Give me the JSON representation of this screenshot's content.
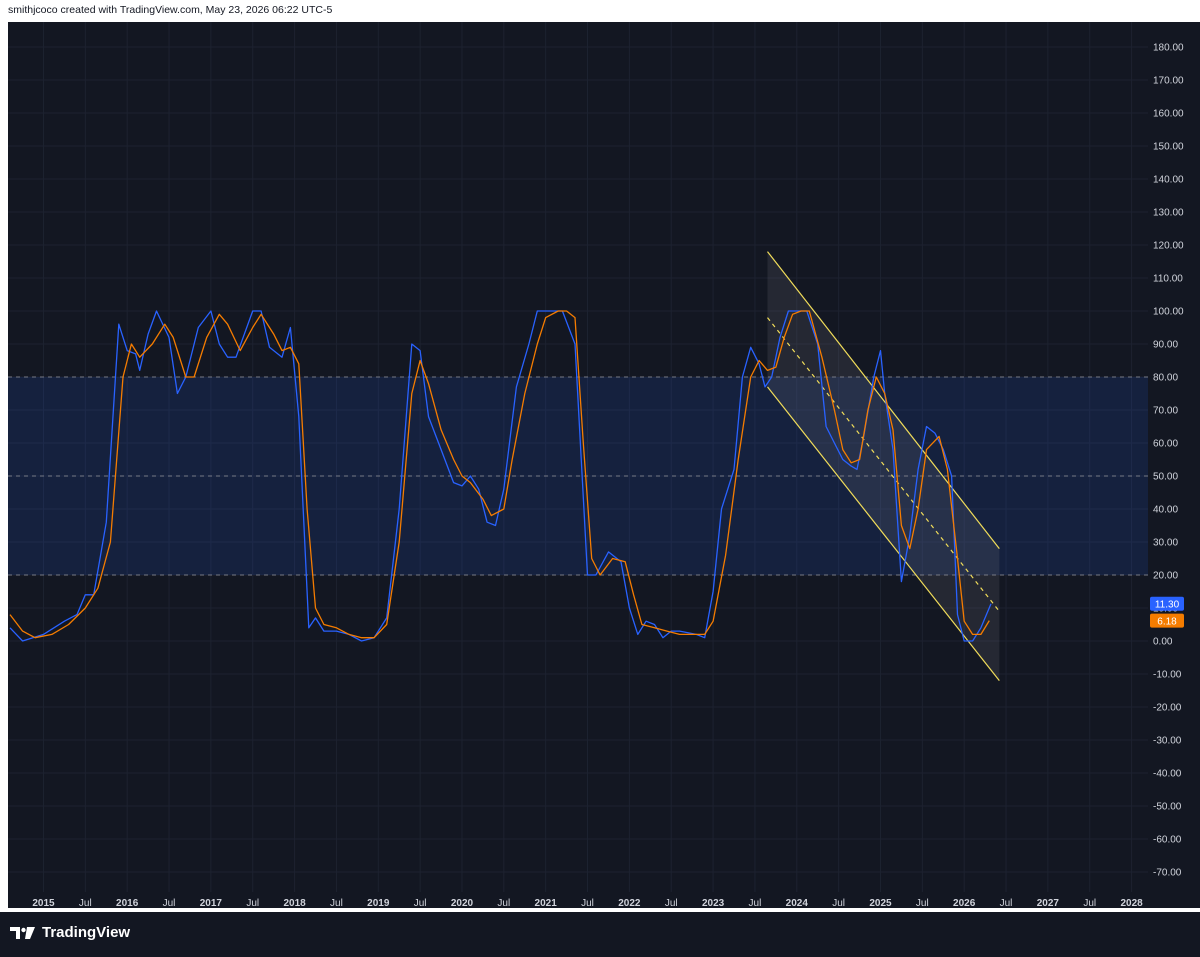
{
  "header": {
    "text": "smithjcoco created with TradingView.com, May 23, 2026 06:22 UTC-5"
  },
  "footer": {
    "brand": "TradingView"
  },
  "chart_data": {
    "type": "line",
    "y_range": [
      -75,
      185
    ],
    "y_ticks": [
      "180.00",
      "170.00",
      "160.00",
      "150.00",
      "140.00",
      "130.00",
      "120.00",
      "110.00",
      "100.00",
      "90.00",
      "80.00",
      "70.00",
      "60.00",
      "50.00",
      "40.00",
      "30.00",
      "20.00",
      "10.00",
      "0.00",
      "-10.00",
      "-20.00",
      "-30.00",
      "-40.00",
      "-50.00",
      "-60.00",
      "-70.00"
    ],
    "x_range": [
      2014.6,
      2028.15
    ],
    "x_ticks": [
      {
        "t": 2015.0,
        "label": "2015",
        "bold": true
      },
      {
        "t": 2015.5,
        "label": "Jul",
        "bold": false
      },
      {
        "t": 2016.0,
        "label": "2016",
        "bold": true
      },
      {
        "t": 2016.5,
        "label": "Jul",
        "bold": false
      },
      {
        "t": 2017.0,
        "label": "2017",
        "bold": true
      },
      {
        "t": 2017.5,
        "label": "Jul",
        "bold": false
      },
      {
        "t": 2018.0,
        "label": "2018",
        "bold": true
      },
      {
        "t": 2018.5,
        "label": "Jul",
        "bold": false
      },
      {
        "t": 2019.0,
        "label": "2019",
        "bold": true
      },
      {
        "t": 2019.5,
        "label": "Jul",
        "bold": false
      },
      {
        "t": 2020.0,
        "label": "2020",
        "bold": true
      },
      {
        "t": 2020.5,
        "label": "Jul",
        "bold": false
      },
      {
        "t": 2021.0,
        "label": "2021",
        "bold": true
      },
      {
        "t": 2021.5,
        "label": "Jul",
        "bold": false
      },
      {
        "t": 2022.0,
        "label": "2022",
        "bold": true
      },
      {
        "t": 2022.5,
        "label": "Jul",
        "bold": false
      },
      {
        "t": 2023.0,
        "label": "2023",
        "bold": true
      },
      {
        "t": 2023.5,
        "label": "Jul",
        "bold": false
      },
      {
        "t": 2024.0,
        "label": "2024",
        "bold": true
      },
      {
        "t": 2024.5,
        "label": "Jul",
        "bold": false
      },
      {
        "t": 2025.0,
        "label": "2025",
        "bold": true
      },
      {
        "t": 2025.5,
        "label": "Jul",
        "bold": false
      },
      {
        "t": 2026.0,
        "label": "2026",
        "bold": true
      },
      {
        "t": 2026.5,
        "label": "Jul",
        "bold": false
      },
      {
        "t": 2027.0,
        "label": "2027",
        "bold": true
      },
      {
        "t": 2027.5,
        "label": "Jul",
        "bold": false
      },
      {
        "t": 2028.0,
        "label": "2028",
        "bold": true
      }
    ],
    "band": {
      "upper": 80,
      "middle": 50,
      "lower": 20
    },
    "series": [
      {
        "key": "k",
        "color": "#2962ff",
        "last_label": "11.30",
        "points": [
          [
            2014.6,
            4
          ],
          [
            2014.75,
            0
          ],
          [
            2015.0,
            2
          ],
          [
            2015.25,
            6
          ],
          [
            2015.4,
            8
          ],
          [
            2015.5,
            14
          ],
          [
            2015.6,
            14
          ],
          [
            2015.75,
            36
          ],
          [
            2015.9,
            96
          ],
          [
            2016.0,
            88
          ],
          [
            2016.1,
            87
          ],
          [
            2016.15,
            82
          ],
          [
            2016.25,
            93
          ],
          [
            2016.35,
            100
          ],
          [
            2016.5,
            92
          ],
          [
            2016.6,
            75
          ],
          [
            2016.7,
            80
          ],
          [
            2016.85,
            95
          ],
          [
            2017.0,
            100
          ],
          [
            2017.1,
            90
          ],
          [
            2017.2,
            86
          ],
          [
            2017.3,
            86
          ],
          [
            2017.5,
            100
          ],
          [
            2017.6,
            100
          ],
          [
            2017.7,
            89
          ],
          [
            2017.85,
            86
          ],
          [
            2017.95,
            95
          ],
          [
            2018.05,
            68
          ],
          [
            2018.17,
            4
          ],
          [
            2018.25,
            7
          ],
          [
            2018.35,
            3
          ],
          [
            2018.5,
            3
          ],
          [
            2018.65,
            2
          ],
          [
            2018.8,
            0
          ],
          [
            2018.95,
            1
          ],
          [
            2019.1,
            7
          ],
          [
            2019.25,
            40
          ],
          [
            2019.4,
            90
          ],
          [
            2019.5,
            88
          ],
          [
            2019.6,
            68
          ],
          [
            2019.75,
            58
          ],
          [
            2019.9,
            48
          ],
          [
            2020.0,
            47
          ],
          [
            2020.1,
            50
          ],
          [
            2020.2,
            46
          ],
          [
            2020.3,
            36
          ],
          [
            2020.4,
            35
          ],
          [
            2020.5,
            46
          ],
          [
            2020.65,
            77
          ],
          [
            2020.8,
            90
          ],
          [
            2020.9,
            100
          ],
          [
            2021.0,
            100
          ],
          [
            2021.1,
            100
          ],
          [
            2021.2,
            100
          ],
          [
            2021.35,
            90
          ],
          [
            2021.5,
            20
          ],
          [
            2021.6,
            20
          ],
          [
            2021.75,
            27
          ],
          [
            2021.9,
            24
          ],
          [
            2022.0,
            10
          ],
          [
            2022.1,
            2
          ],
          [
            2022.2,
            6
          ],
          [
            2022.3,
            5
          ],
          [
            2022.4,
            1
          ],
          [
            2022.5,
            3
          ],
          [
            2022.6,
            3
          ],
          [
            2022.8,
            2
          ],
          [
            2022.9,
            1
          ],
          [
            2023.0,
            15
          ],
          [
            2023.1,
            40
          ],
          [
            2023.25,
            52
          ],
          [
            2023.35,
            80
          ],
          [
            2023.45,
            89
          ],
          [
            2023.55,
            84
          ],
          [
            2023.62,
            77
          ],
          [
            2023.7,
            80
          ],
          [
            2023.8,
            92
          ],
          [
            2023.9,
            100
          ],
          [
            2024.0,
            100
          ],
          [
            2024.12,
            100
          ],
          [
            2024.25,
            90
          ],
          [
            2024.35,
            65
          ],
          [
            2024.45,
            60
          ],
          [
            2024.55,
            55
          ],
          [
            2024.65,
            53
          ],
          [
            2024.72,
            52
          ],
          [
            2024.8,
            62
          ],
          [
            2024.92,
            80
          ],
          [
            2025.0,
            88
          ],
          [
            2025.05,
            75
          ],
          [
            2025.15,
            58
          ],
          [
            2025.25,
            18
          ],
          [
            2025.35,
            32
          ],
          [
            2025.45,
            52
          ],
          [
            2025.55,
            65
          ],
          [
            2025.65,
            63
          ],
          [
            2025.75,
            58
          ],
          [
            2025.85,
            50
          ],
          [
            2025.92,
            8
          ],
          [
            2026.0,
            0
          ],
          [
            2026.1,
            0
          ],
          [
            2026.2,
            4
          ],
          [
            2026.32,
            11.3
          ]
        ]
      },
      {
        "key": "d",
        "color": "#f57c00",
        "last_label": "6.18",
        "points": [
          [
            2014.6,
            8
          ],
          [
            2014.75,
            3
          ],
          [
            2014.9,
            1
          ],
          [
            2015.1,
            2
          ],
          [
            2015.3,
            5
          ],
          [
            2015.5,
            10
          ],
          [
            2015.65,
            16
          ],
          [
            2015.8,
            30
          ],
          [
            2015.95,
            80
          ],
          [
            2016.05,
            90
          ],
          [
            2016.15,
            86
          ],
          [
            2016.3,
            90
          ],
          [
            2016.45,
            96
          ],
          [
            2016.55,
            92
          ],
          [
            2016.7,
            80
          ],
          [
            2016.8,
            80
          ],
          [
            2016.95,
            92
          ],
          [
            2017.1,
            99
          ],
          [
            2017.2,
            96
          ],
          [
            2017.35,
            88
          ],
          [
            2017.5,
            95
          ],
          [
            2017.6,
            99
          ],
          [
            2017.75,
            93
          ],
          [
            2017.85,
            88
          ],
          [
            2017.95,
            89
          ],
          [
            2018.05,
            84
          ],
          [
            2018.15,
            40
          ],
          [
            2018.25,
            10
          ],
          [
            2018.35,
            5
          ],
          [
            2018.5,
            4
          ],
          [
            2018.65,
            2
          ],
          [
            2018.8,
            1
          ],
          [
            2018.95,
            1
          ],
          [
            2019.1,
            5
          ],
          [
            2019.25,
            30
          ],
          [
            2019.4,
            75
          ],
          [
            2019.5,
            85
          ],
          [
            2019.6,
            78
          ],
          [
            2019.75,
            64
          ],
          [
            2019.9,
            55
          ],
          [
            2020.0,
            50
          ],
          [
            2020.1,
            48
          ],
          [
            2020.25,
            43
          ],
          [
            2020.35,
            38
          ],
          [
            2020.5,
            40
          ],
          [
            2020.6,
            55
          ],
          [
            2020.75,
            75
          ],
          [
            2020.9,
            90
          ],
          [
            2021.0,
            98
          ],
          [
            2021.15,
            100
          ],
          [
            2021.25,
            100
          ],
          [
            2021.35,
            98
          ],
          [
            2021.45,
            60
          ],
          [
            2021.55,
            25
          ],
          [
            2021.65,
            20
          ],
          [
            2021.8,
            25
          ],
          [
            2021.95,
            24
          ],
          [
            2022.05,
            14
          ],
          [
            2022.15,
            5
          ],
          [
            2022.3,
            4
          ],
          [
            2022.45,
            3
          ],
          [
            2022.6,
            2
          ],
          [
            2022.75,
            2
          ],
          [
            2022.9,
            2
          ],
          [
            2023.0,
            6
          ],
          [
            2023.15,
            26
          ],
          [
            2023.3,
            55
          ],
          [
            2023.45,
            80
          ],
          [
            2023.55,
            85
          ],
          [
            2023.65,
            82
          ],
          [
            2023.75,
            83
          ],
          [
            2023.85,
            92
          ],
          [
            2023.95,
            99
          ],
          [
            2024.05,
            100
          ],
          [
            2024.15,
            100
          ],
          [
            2024.3,
            86
          ],
          [
            2024.45,
            70
          ],
          [
            2024.55,
            58
          ],
          [
            2024.65,
            54
          ],
          [
            2024.75,
            55
          ],
          [
            2024.85,
            70
          ],
          [
            2024.95,
            80
          ],
          [
            2025.05,
            75
          ],
          [
            2025.15,
            64
          ],
          [
            2025.25,
            35
          ],
          [
            2025.35,
            28
          ],
          [
            2025.45,
            40
          ],
          [
            2025.55,
            58
          ],
          [
            2025.7,
            62
          ],
          [
            2025.8,
            52
          ],
          [
            2025.92,
            25
          ],
          [
            2026.0,
            6
          ],
          [
            2026.1,
            2
          ],
          [
            2026.2,
            2
          ],
          [
            2026.3,
            6.18
          ]
        ]
      }
    ],
    "channel": {
      "upper": [
        [
          2023.65,
          118
        ],
        [
          2026.42,
          28
        ]
      ],
      "middle": [
        [
          2023.65,
          98
        ],
        [
          2026.42,
          9
        ]
      ],
      "lower": [
        [
          2023.65,
          77
        ],
        [
          2026.42,
          -12
        ]
      ],
      "shade_x": [
        2023.65,
        2026.42
      ]
    }
  }
}
